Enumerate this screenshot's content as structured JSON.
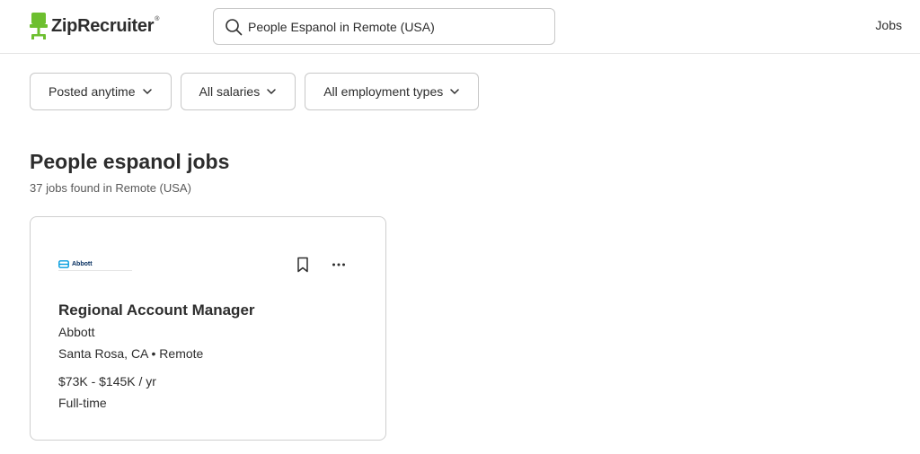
{
  "header": {
    "logo_text": "ZipRecruiter",
    "logo_tm": "®",
    "brand_color": "#6dbf2f",
    "search": {
      "value": "People Espanol in Remote (USA)",
      "placeholder": "Search jobs",
      "icon": "search-icon"
    },
    "nav_jobs_label": "Jobs"
  },
  "filters": [
    {
      "label": "Posted anytime",
      "icon": "chevron-down-icon"
    },
    {
      "label": "All salaries",
      "icon": "chevron-down-icon"
    },
    {
      "label": "All employment types",
      "icon": "chevron-down-icon"
    }
  ],
  "results": {
    "title": "People espanol jobs",
    "count_text": "37 jobs found in Remote (USA)"
  },
  "jobs": [
    {
      "company_logo_text": "Abbott",
      "title": "Regional Account Manager",
      "company": "Abbott",
      "location": "Santa Rosa, CA • Remote",
      "salary": "$73K - $145K / yr",
      "employment_type": "Full-time",
      "save_icon": "bookmark-icon",
      "more_icon": "more-options-icon"
    }
  ]
}
